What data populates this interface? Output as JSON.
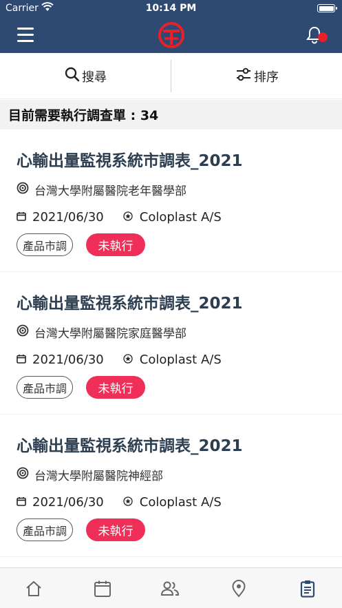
{
  "status_bar": {
    "carrier": "Carrier",
    "time": "10:14 PM"
  },
  "nav": {
    "menu_icon": "hamburger-menu-icon",
    "logo_icon": "brand-logo-icon",
    "bell_icon": "bell-icon",
    "brand_color": "#2f4a72",
    "notification_dot_color": "#e8202a"
  },
  "toolbar": {
    "search_label": "搜尋",
    "sort_label": "排序"
  },
  "summary": {
    "count_text": "目前需要執行調查單 : 34"
  },
  "cards": [
    {
      "title": "心輸出量監視系統市調表_2021",
      "organization": "台灣大學附屬醫院老年醫學部",
      "date": "2021/06/30",
      "client": "Coloplast A/S",
      "type_tag": "產品市調",
      "status_tag": "未執行"
    },
    {
      "title": "心輸出量監視系統市調表_2021",
      "organization": "台灣大學附屬醫院家庭醫學部",
      "date": "2021/06/30",
      "client": "Coloplast A/S",
      "type_tag": "產品市調",
      "status_tag": "未執行"
    },
    {
      "title": "心輸出量監視系統市調表_2021",
      "organization": "台灣大學附屬醫院神經部",
      "date": "2021/06/30",
      "client": "Coloplast A/S",
      "type_tag": "產品市調",
      "status_tag": "未執行"
    }
  ],
  "status_color": "#ef2f57",
  "tabbar": {
    "icons": [
      "home-icon",
      "calendar-icon",
      "people-icon",
      "location-pin-icon",
      "clipboard-icon"
    ],
    "active_index": 4,
    "active_color": "#2f4a72"
  }
}
